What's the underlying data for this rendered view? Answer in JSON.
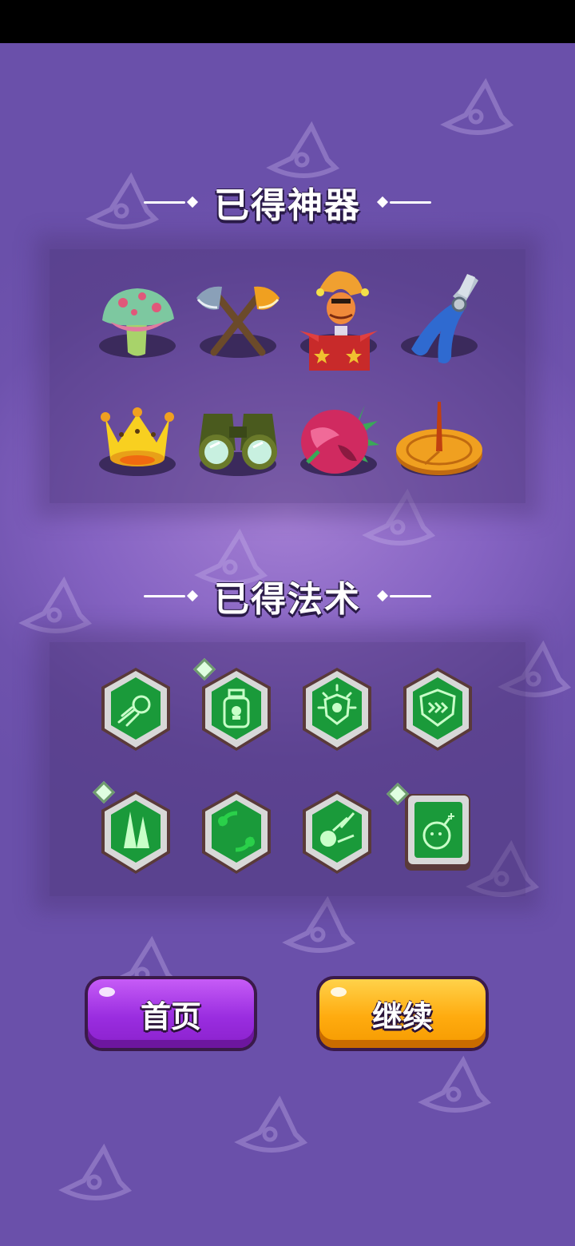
{
  "sections": {
    "artifacts_title": "已得神器",
    "spells_title": "已得法术"
  },
  "artifacts": [
    {
      "icon": "mushroom-icon"
    },
    {
      "icon": "crossed-axes-icon"
    },
    {
      "icon": "jack-in-the-box-icon"
    },
    {
      "icon": "pliers-icon"
    },
    {
      "icon": "crown-icon"
    },
    {
      "icon": "binoculars-icon"
    },
    {
      "icon": "dragon-fruit-icon"
    },
    {
      "icon": "sundial-icon"
    }
  ],
  "spells": [
    {
      "icon": "fireball-spell-icon",
      "new_badge": false
    },
    {
      "icon": "poison-bottle-spell-icon",
      "new_badge": true
    },
    {
      "icon": "skull-shield-spell-icon",
      "new_badge": false
    },
    {
      "icon": "speed-shield-spell-icon",
      "new_badge": false
    },
    {
      "icon": "twin-spikes-spell-icon",
      "new_badge": true
    },
    {
      "icon": "orbit-spell-icon",
      "new_badge": false
    },
    {
      "icon": "skull-lightning-spell-icon",
      "new_badge": false
    },
    {
      "icon": "bomb-spell-icon",
      "new_badge": true
    }
  ],
  "buttons": {
    "home_label": "首页",
    "continue_label": "继续"
  },
  "colors": {
    "background": "#8563c2",
    "home_button": "#9a2de0",
    "continue_button": "#ffab0f",
    "spell_green": "#1a9a3a"
  }
}
